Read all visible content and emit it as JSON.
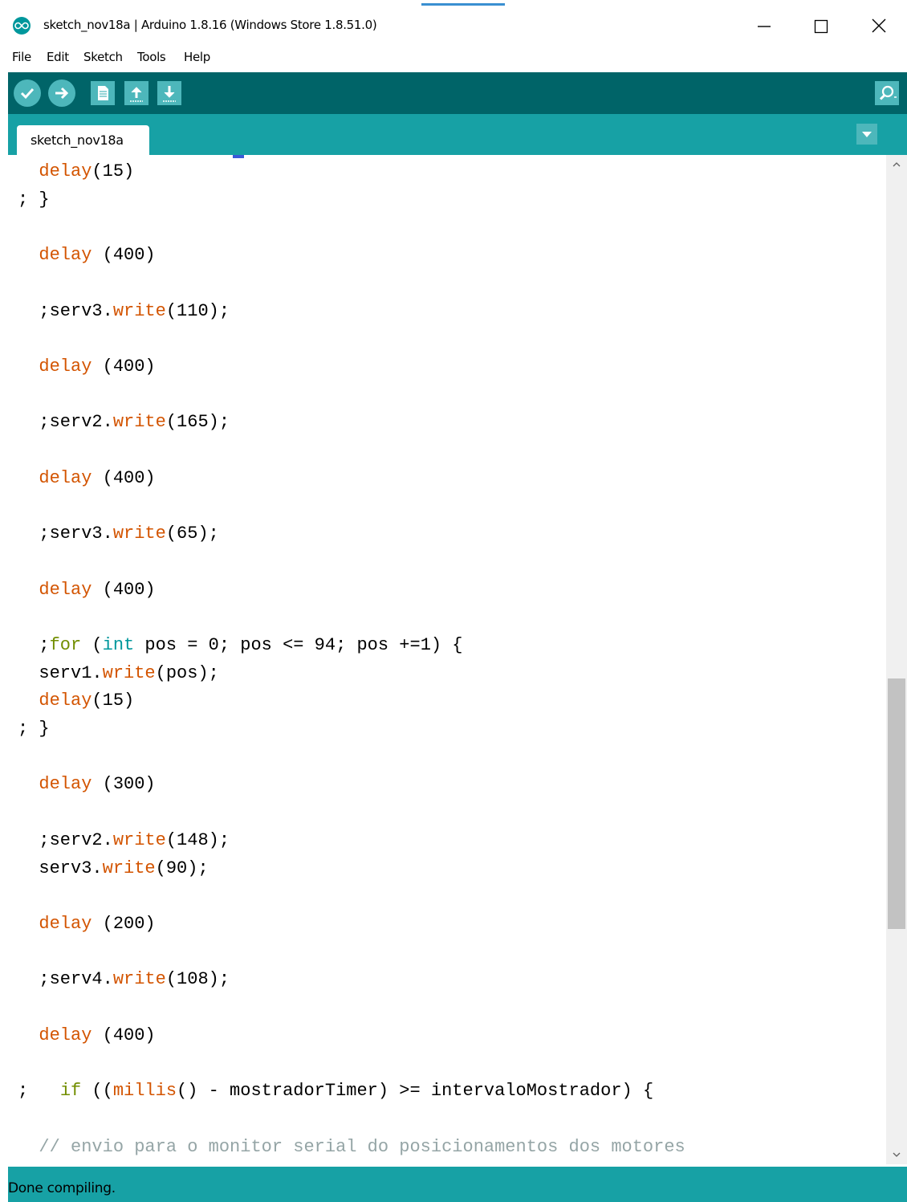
{
  "window": {
    "title": "sketch_nov18a | Arduino 1.8.16 (Windows Store 1.8.51.0)",
    "icons": [
      "arduino-logo-icon",
      "minimize-icon",
      "maximize-icon",
      "close-icon"
    ]
  },
  "menu": {
    "items": [
      "File",
      "Edit",
      "Sketch",
      "Tools",
      "Help"
    ]
  },
  "toolbar": {
    "buttons": [
      "verify-icon",
      "upload-icon",
      "new-icon",
      "open-icon",
      "save-icon",
      "serial-monitor-icon"
    ]
  },
  "tabs": {
    "active": "sketch_nov18a"
  },
  "colors": {
    "toolbar_bg": "#006468",
    "tabbar_bg": "#17a1a5",
    "keyword": "#d35400",
    "control": "#728e00",
    "type": "#00979c",
    "comment": "#95a5a6"
  },
  "code": [
    {
      "indent": "  ",
      "tokens": [
        {
          "t": "delay",
          "c": "k"
        },
        {
          "t": "(15)",
          "c": ""
        }
      ]
    },
    {
      "indent": "",
      "tokens": [
        {
          "t": "; }",
          "c": ""
        }
      ]
    },
    {
      "indent": "",
      "tokens": []
    },
    {
      "indent": "  ",
      "tokens": [
        {
          "t": "delay",
          "c": "k"
        },
        {
          "t": " (400)",
          "c": ""
        }
      ]
    },
    {
      "indent": "",
      "tokens": []
    },
    {
      "indent": "  ",
      "tokens": [
        {
          "t": ";serv3.",
          "c": ""
        },
        {
          "t": "write",
          "c": "k"
        },
        {
          "t": "(110);",
          "c": ""
        }
      ]
    },
    {
      "indent": "",
      "tokens": []
    },
    {
      "indent": "  ",
      "tokens": [
        {
          "t": "delay",
          "c": "k"
        },
        {
          "t": " (400)",
          "c": ""
        }
      ]
    },
    {
      "indent": "",
      "tokens": []
    },
    {
      "indent": "  ",
      "tokens": [
        {
          "t": ";serv2.",
          "c": ""
        },
        {
          "t": "write",
          "c": "k"
        },
        {
          "t": "(165);",
          "c": ""
        }
      ]
    },
    {
      "indent": "",
      "tokens": []
    },
    {
      "indent": "  ",
      "tokens": [
        {
          "t": "delay",
          "c": "k"
        },
        {
          "t": " (400)",
          "c": ""
        }
      ]
    },
    {
      "indent": "",
      "tokens": []
    },
    {
      "indent": "  ",
      "tokens": [
        {
          "t": ";serv3.",
          "c": ""
        },
        {
          "t": "write",
          "c": "k"
        },
        {
          "t": "(65);",
          "c": ""
        }
      ]
    },
    {
      "indent": "",
      "tokens": []
    },
    {
      "indent": "  ",
      "tokens": [
        {
          "t": "delay",
          "c": "k"
        },
        {
          "t": " (400)",
          "c": ""
        }
      ]
    },
    {
      "indent": "",
      "tokens": []
    },
    {
      "indent": "  ",
      "tokens": [
        {
          "t": ";",
          "c": ""
        },
        {
          "t": "for",
          "c": "g"
        },
        {
          "t": " (",
          "c": ""
        },
        {
          "t": "int",
          "c": "b"
        },
        {
          "t": " pos = 0; pos <= 94; pos +=1) {",
          "c": ""
        }
      ]
    },
    {
      "indent": "  ",
      "tokens": [
        {
          "t": "serv1.",
          "c": ""
        },
        {
          "t": "write",
          "c": "k"
        },
        {
          "t": "(pos);",
          "c": ""
        }
      ]
    },
    {
      "indent": "  ",
      "tokens": [
        {
          "t": "delay",
          "c": "k"
        },
        {
          "t": "(15)",
          "c": ""
        }
      ]
    },
    {
      "indent": "",
      "tokens": [
        {
          "t": "; }",
          "c": ""
        }
      ]
    },
    {
      "indent": "",
      "tokens": []
    },
    {
      "indent": "  ",
      "tokens": [
        {
          "t": "delay",
          "c": "k"
        },
        {
          "t": " (300)",
          "c": ""
        }
      ]
    },
    {
      "indent": "",
      "tokens": []
    },
    {
      "indent": "  ",
      "tokens": [
        {
          "t": ";serv2.",
          "c": ""
        },
        {
          "t": "write",
          "c": "k"
        },
        {
          "t": "(148);",
          "c": ""
        }
      ]
    },
    {
      "indent": "  ",
      "tokens": [
        {
          "t": "serv3.",
          "c": ""
        },
        {
          "t": "write",
          "c": "k"
        },
        {
          "t": "(90);",
          "c": ""
        }
      ]
    },
    {
      "indent": "",
      "tokens": []
    },
    {
      "indent": "  ",
      "tokens": [
        {
          "t": "delay",
          "c": "k"
        },
        {
          "t": " (200)",
          "c": ""
        }
      ]
    },
    {
      "indent": "",
      "tokens": []
    },
    {
      "indent": "  ",
      "tokens": [
        {
          "t": ";serv4.",
          "c": ""
        },
        {
          "t": "write",
          "c": "k"
        },
        {
          "t": "(108);",
          "c": ""
        }
      ]
    },
    {
      "indent": "",
      "tokens": []
    },
    {
      "indent": "  ",
      "tokens": [
        {
          "t": "delay",
          "c": "k"
        },
        {
          "t": " (400)",
          "c": ""
        }
      ]
    },
    {
      "indent": "",
      "tokens": []
    },
    {
      "indent": "",
      "tokens": [
        {
          "t": ";   ",
          "c": ""
        },
        {
          "t": "if",
          "c": "g"
        },
        {
          "t": " ((",
          "c": ""
        },
        {
          "t": "millis",
          "c": "k"
        },
        {
          "t": "() - mostradorTimer) >= intervaloMostrador) {",
          "c": ""
        }
      ]
    },
    {
      "indent": "",
      "tokens": []
    },
    {
      "indent": "  ",
      "tokens": [
        {
          "t": "// envio para o monitor serial do posicionamentos dos motores",
          "c": "c"
        }
      ]
    }
  ],
  "status": {
    "message": "Done compiling."
  }
}
